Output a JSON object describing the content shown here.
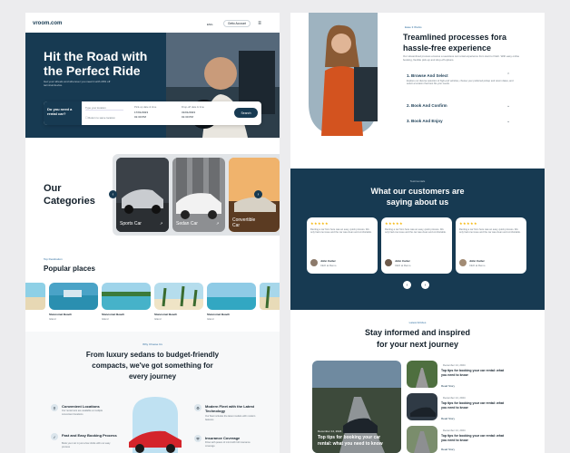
{
  "left": {
    "logo": "vroom.com",
    "nav": {
      "lang": "ENG",
      "cta": "Getto Account"
    },
    "hero": {
      "title1": "Hit the Road with",
      "title2": "the Perfect Ride",
      "subtitle": "Get your wheels and wherever you need it with 20% off terminal device.",
      "search_label": "Do you need a rental car?",
      "location_placeholder": "Type your location",
      "return_label": "Return to same location",
      "pickup_label": "Pick-up date & time",
      "pickup_value": "17/01/2023",
      "pickup_time": "01:30 PM",
      "dropoff_label": "Drop-off date & time",
      "dropoff_value": "31/01/2023",
      "dropoff_time": "01:30 PM",
      "search_btn": "Search"
    },
    "categories": {
      "title1": "Our",
      "title2": "Categories",
      "items": [
        "Sports Car",
        "Sedan Car",
        "Convertible Car"
      ]
    },
    "places": {
      "tag": "Top Destination",
      "title": "Popular places",
      "items": [
        {
          "name": "Stancomet Beach",
          "sub": "Island"
        },
        {
          "name": "Stancomet Beach",
          "sub": "Island"
        },
        {
          "name": "Stancomet Beach",
          "sub": "Island"
        },
        {
          "name": "Stancomet Beach",
          "sub": "Island"
        }
      ]
    },
    "why": {
      "tag": "Why Choose Us",
      "title1": "From luxury sedans to budget-friendly",
      "title2": "compacts, we've got something for",
      "title3": "every journey",
      "features": [
        {
          "title": "Convenient Locations",
          "desc": "Our rental cars are available at multiple convenient locations"
        },
        {
          "title": "Modern Fleet with the Latest Technology",
          "desc": "Our fleet includes the latest models with modern features"
        },
        {
          "title": "Fast and Easy Booking Process",
          "desc": "Book your car in just a few clicks with our easy process"
        },
        {
          "title": "Insurance Coverage",
          "desc": "Drive with peace of mind with full insurance coverage"
        }
      ]
    }
  },
  "right": {
    "steps": {
      "tag": "Ease 3 Works",
      "title1": "Treamlined processes fora",
      "title2": "hassle-free experience",
      "desc": "Our streamlined process ensures a seamless car rental experience from start to finish. With easy online booking, flexible pick-up and drop-off options.",
      "items": [
        {
          "label": "1. Browse And Select",
          "desc": "Explore our diverse selection of high-end vehicles, choose your preferred pickup and return dates, and select a location that best fits your needs."
        },
        {
          "label": "2. Book And Confirm"
        },
        {
          "label": "3. Book And Enjoy"
        }
      ]
    },
    "testimonials": {
      "tag": "Testimonials",
      "title1": "What our customers are",
      "title2": "saying about us",
      "stars": "★★★★★",
      "text": "Renting a car from here was an easy, quick process. We only had one issue and the car was clean and comfortable.",
      "name": "John Carter",
      "role": "CEO at Remo"
    },
    "blog": {
      "tag": "Latest Articles",
      "title1": "Stay informed and inspired",
      "title2": "for your next journey",
      "main_date": "December 14, 2024",
      "main_title1": "Top tips for booking your car",
      "main_title2": "rental: what you need to know",
      "side": [
        {
          "date": "December 14, 2024",
          "title1": "Top tips for booking your car rental: what",
          "title2": "you need to know",
          "more": "Read Story"
        },
        {
          "date": "December 14, 2024",
          "title1": "Top tips for booking your car rental: what",
          "title2": "you need to know",
          "more": "Read Story"
        },
        {
          "date": "December 14, 2024",
          "title1": "Top tips for booking your car rental: what",
          "title2": "you need to know",
          "more": "Read Story"
        }
      ]
    }
  }
}
